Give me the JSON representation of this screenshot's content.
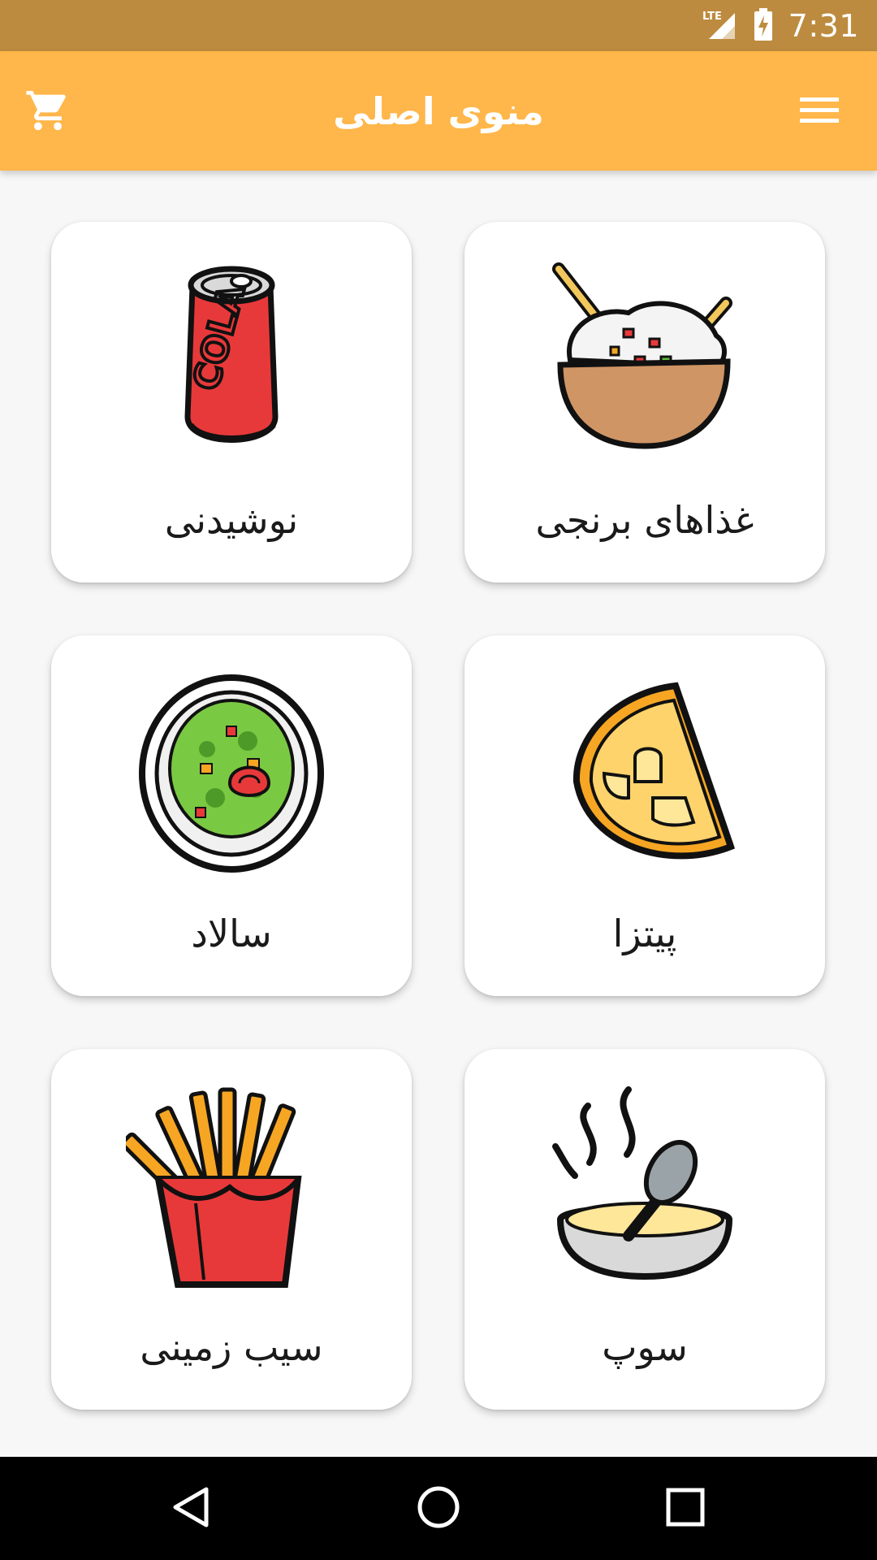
{
  "status_bar": {
    "network": "LTE",
    "time": "7:31",
    "icons": [
      "lte-signal-icon",
      "battery-charging-icon"
    ]
  },
  "app_bar": {
    "title": "منوی اصلی",
    "left_icon": "cart-icon",
    "right_icon": "hamburger-menu-icon",
    "background": "#ffb64a"
  },
  "categories": [
    {
      "label": "نوشیدنی",
      "icon": "cola-can-icon"
    },
    {
      "label": "غذاهای برنجی",
      "icon": "rice-bowl-icon"
    },
    {
      "label": "سالاد",
      "icon": "salad-plate-icon"
    },
    {
      "label": "پیتزا",
      "icon": "pizza-slice-icon"
    },
    {
      "label": "سیب زمینی",
      "icon": "french-fries-icon"
    },
    {
      "label": "سوپ",
      "icon": "soup-bowl-icon"
    }
  ],
  "nav_bar": {
    "icons": [
      "back-icon",
      "home-icon",
      "recents-icon"
    ]
  },
  "colors": {
    "status_bar": "#bd8b3f",
    "app_bar": "#ffb64a",
    "background": "#f7f7f7",
    "card": "#ffffff"
  }
}
